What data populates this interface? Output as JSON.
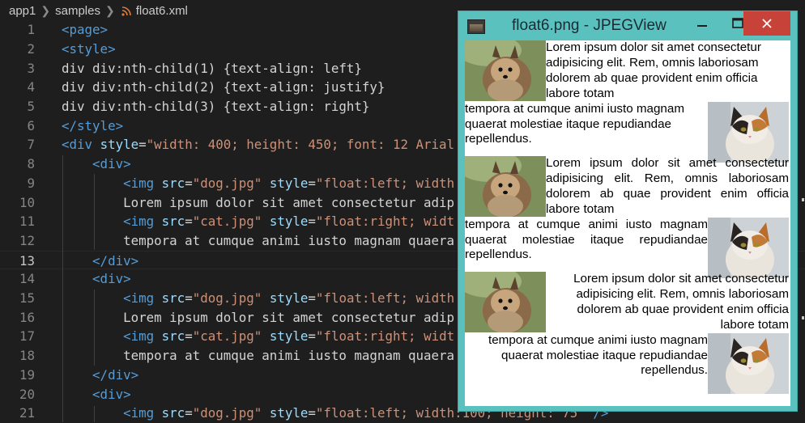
{
  "breadcrumb": {
    "items": [
      "app1",
      "samples",
      "float6.xml"
    ],
    "file_icon": "rss-feed-icon"
  },
  "editor": {
    "lines": [
      {
        "n": "1",
        "parts": [
          [
            "tag",
            "<page>"
          ]
        ]
      },
      {
        "n": "2",
        "parts": [
          [
            "tag",
            "<style>"
          ]
        ]
      },
      {
        "n": "3",
        "parts": [
          [
            "txt",
            "div div:nth-child(1) {text-align: left}"
          ]
        ]
      },
      {
        "n": "4",
        "parts": [
          [
            "txt",
            "div div:nth-child(2) {text-align: justify}"
          ]
        ]
      },
      {
        "n": "5",
        "parts": [
          [
            "txt",
            "div div:nth-child(3) {text-align: right}"
          ]
        ]
      },
      {
        "n": "6",
        "parts": [
          [
            "tag",
            "</style>"
          ]
        ]
      },
      {
        "n": "7",
        "parts": [
          [
            "tag",
            "<div "
          ],
          [
            "attr",
            "style"
          ],
          [
            "txt",
            "="
          ],
          [
            "str",
            "\"width: 400; height: 450; font: 12 Arial"
          ]
        ]
      },
      {
        "n": "8",
        "parts": [
          [
            "txt",
            "    "
          ],
          [
            "tag",
            "<div>"
          ]
        ]
      },
      {
        "n": "9",
        "parts": [
          [
            "txt",
            "        "
          ],
          [
            "tag",
            "<img "
          ],
          [
            "attr",
            "src"
          ],
          [
            "txt",
            "="
          ],
          [
            "str",
            "\"dog.jpg\""
          ],
          [
            "txt",
            " "
          ],
          [
            "attr",
            "style"
          ],
          [
            "txt",
            "="
          ],
          [
            "str",
            "\"float:left; width"
          ]
        ]
      },
      {
        "n": "10",
        "parts": [
          [
            "txt",
            "        Lorem ipsum dolor sit amet consectetur adip"
          ]
        ]
      },
      {
        "n": "11",
        "parts": [
          [
            "txt",
            "        "
          ],
          [
            "tag",
            "<img "
          ],
          [
            "attr",
            "src"
          ],
          [
            "txt",
            "="
          ],
          [
            "str",
            "\"cat.jpg\""
          ],
          [
            "txt",
            " "
          ],
          [
            "attr",
            "style"
          ],
          [
            "txt",
            "="
          ],
          [
            "str",
            "\"float:right; widt"
          ]
        ]
      },
      {
        "n": "12",
        "parts": [
          [
            "txt",
            "        tempora at cumque animi iusto magnam quaera"
          ]
        ]
      },
      {
        "n": "13",
        "parts": [
          [
            "txt",
            "    "
          ],
          [
            "tag",
            "</div>"
          ]
        ]
      },
      {
        "n": "14",
        "parts": [
          [
            "txt",
            "    "
          ],
          [
            "tag",
            "<div>"
          ]
        ]
      },
      {
        "n": "15",
        "parts": [
          [
            "txt",
            "        "
          ],
          [
            "tag",
            "<img "
          ],
          [
            "attr",
            "src"
          ],
          [
            "txt",
            "="
          ],
          [
            "str",
            "\"dog.jpg\""
          ],
          [
            "txt",
            " "
          ],
          [
            "attr",
            "style"
          ],
          [
            "txt",
            "="
          ],
          [
            "str",
            "\"float:left; width"
          ]
        ]
      },
      {
        "n": "16",
        "parts": [
          [
            "txt",
            "        Lorem ipsum dolor sit amet consectetur adip"
          ]
        ]
      },
      {
        "n": "17",
        "parts": [
          [
            "txt",
            "        "
          ],
          [
            "tag",
            "<img "
          ],
          [
            "attr",
            "src"
          ],
          [
            "txt",
            "="
          ],
          [
            "str",
            "\"cat.jpg\""
          ],
          [
            "txt",
            " "
          ],
          [
            "attr",
            "style"
          ],
          [
            "txt",
            "="
          ],
          [
            "str",
            "\"float:right; widt"
          ]
        ]
      },
      {
        "n": "18",
        "parts": [
          [
            "txt",
            "        tempora at cumque animi iusto magnam quaera"
          ]
        ]
      },
      {
        "n": "19",
        "parts": [
          [
            "txt",
            "    "
          ],
          [
            "tag",
            "</div>"
          ]
        ]
      },
      {
        "n": "20",
        "parts": [
          [
            "txt",
            "    "
          ],
          [
            "tag",
            "<div>"
          ]
        ]
      },
      {
        "n": "21",
        "parts": [
          [
            "txt",
            "        "
          ],
          [
            "tag",
            "<img "
          ],
          [
            "attr",
            "src"
          ],
          [
            "txt",
            "="
          ],
          [
            "str",
            "\"dog.jpg\""
          ],
          [
            "txt",
            " "
          ],
          [
            "attr",
            "style"
          ],
          [
            "txt",
            "="
          ],
          [
            "str",
            "\"float:left; width:100; height: 75\""
          ],
          [
            "txt",
            " "
          ],
          [
            "tag",
            "/>"
          ]
        ]
      }
    ],
    "current_line": "13"
  },
  "viewer": {
    "title": "float6.png - JPEGView",
    "minimize_icon": "minimize-icon",
    "maximize_icon": "maximize-icon",
    "close_icon": "close-icon",
    "text_1": "Lorem ipsum dolor sit amet consectetur adipisicing elit. Rem, omnis laboriosam dolorem ab quae provident enim officia labore totam",
    "text_2": "tempora at cumque animi iusto magnam quaerat molestiae itaque repudiandae repellendus.",
    "colors": {
      "close": "#c7433a",
      "frame": "#5bc1bf"
    }
  }
}
